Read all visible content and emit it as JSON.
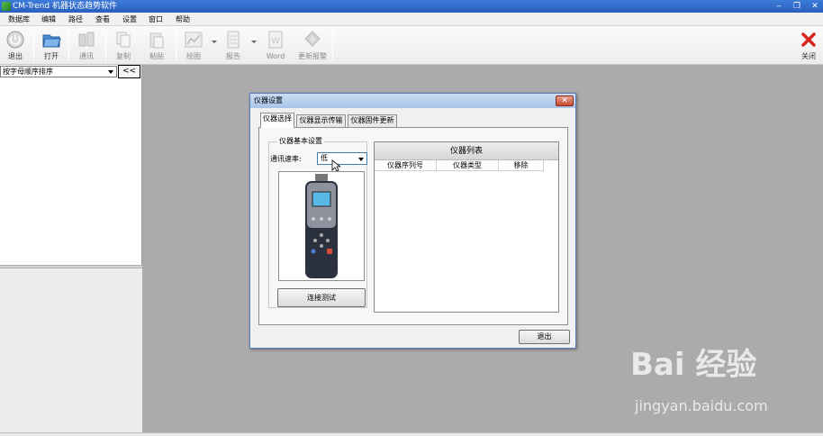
{
  "window": {
    "title": "CM-Trend 机器状态趋势软件",
    "minimize": "‒",
    "restore": "❐",
    "close": "✕"
  },
  "menu": [
    "数据库",
    "编辑",
    "路径",
    "查看",
    "设置",
    "窗口",
    "帮助"
  ],
  "toolbar": {
    "exit": "退出",
    "open": "打开",
    "comm": "通讯",
    "copy": "复制",
    "paste": "粘贴",
    "plot": "绘图",
    "report": "报告",
    "word": "Word",
    "update": "更新报警",
    "close": "关闭"
  },
  "left_panel": {
    "sort_value": "按字母顺序排序",
    "collapse_label": "<<"
  },
  "dialog": {
    "title": "仪器设置",
    "close": "✕",
    "tabs": [
      "仪器选择",
      "仪器显示传输",
      "仪器固件更新"
    ],
    "group_title": "仪器基本设置",
    "baud_label": "通讯速率:",
    "baud_value": "低",
    "connect_button": "连接测试",
    "list_title": "仪器列表",
    "columns": [
      "仪器序列号",
      "仪器类型",
      "移除"
    ],
    "exit_button": "退出"
  },
  "watermark": {
    "logo": "Bai  经验",
    "url": "jingyan.baidu.com"
  },
  "colors": {
    "title_bar": "#2a5fc0",
    "mdi_background": "#ababab",
    "close_red": "#d8261f"
  }
}
